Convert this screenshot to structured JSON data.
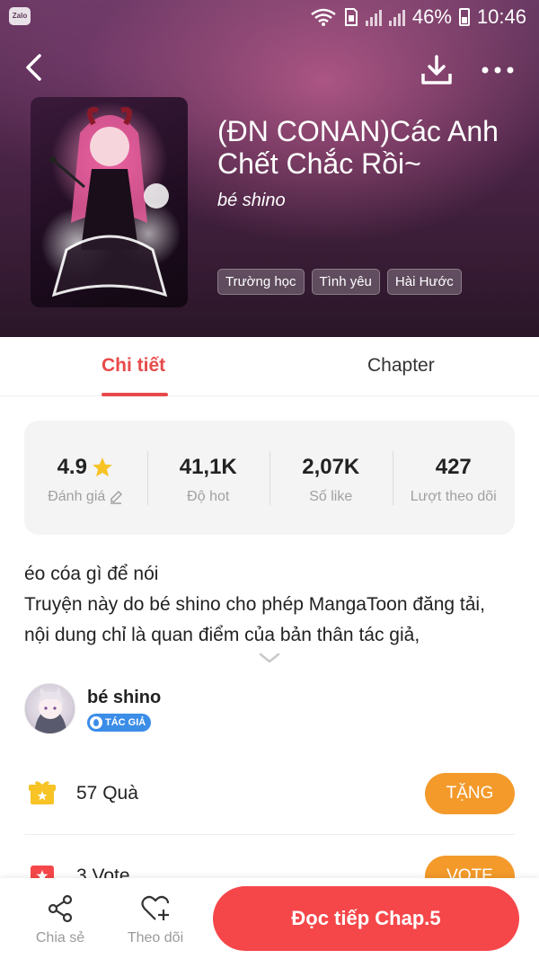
{
  "status_bar": {
    "app_icon_label": "Zalo",
    "battery": "46%",
    "time": "10:46"
  },
  "header": {
    "back_icon": "back-arrow-icon",
    "download_icon": "download-icon",
    "more_icon": "more-dots-icon"
  },
  "comic": {
    "title": "(ĐN CONAN)Các Anh Chết Chắc Rồi~",
    "author": "bé shino",
    "tags": [
      "Trường học",
      "Tình yêu",
      "Hài Hước"
    ]
  },
  "tabs": [
    {
      "label": "Chi tiết",
      "active": true
    },
    {
      "label": "Chapter",
      "active": false
    }
  ],
  "stats": [
    {
      "value": "4.9",
      "label": "Đánh giá",
      "icon": "star-icon",
      "label_icon": "edit-icon"
    },
    {
      "value": "41,1K",
      "label": "Độ hot"
    },
    {
      "value": "2,07K",
      "label": "Số like"
    },
    {
      "value": "427",
      "label": "Lượt theo dõi"
    }
  ],
  "description": {
    "line1": "éo cóa gì để nói",
    "line2": "Truyện này do bé shino cho phép MangaToon đăng tải, nội dung chỉ là quan điểm của bản thân tác giả,"
  },
  "author_card": {
    "name": "bé shino",
    "badge": "TÁC GIẢ"
  },
  "gift": {
    "text": "57 Quà",
    "button": "TẶNG"
  },
  "vote": {
    "text": "3 Vote",
    "button": "VOTE"
  },
  "bottom_bar": {
    "share_label": "Chia sẻ",
    "follow_label": "Theo dõi",
    "read_button": "Đọc tiếp Chap.5"
  },
  "colors": {
    "accent_red": "#e84a4a",
    "read_button": "#f5474a",
    "gift_button": "#f39a2b",
    "author_badge": "#3b8de8"
  }
}
